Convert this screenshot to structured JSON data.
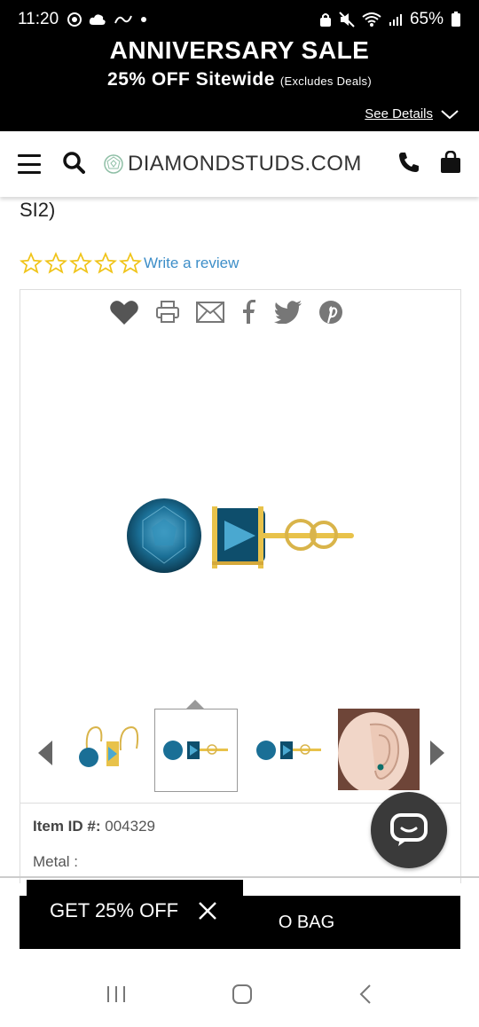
{
  "status_bar": {
    "time": "11:20",
    "battery": "65%"
  },
  "promo": {
    "title": "ANNIVERSARY SALE",
    "subtitle": "25% OFF Sitewide",
    "note": "(Excludes Deals)",
    "details_link": "See Details"
  },
  "header": {
    "logo_text": "DIAMONDSTUDS.COM"
  },
  "product": {
    "name_fragment": "SI2)",
    "rating_stars": 0,
    "review_link": "Write a review"
  },
  "info": {
    "item_id_label": "Item ID #:",
    "item_id_value": "004329",
    "metal_label": "Metal :"
  },
  "bottom": {
    "add_bag_label": "O BAG",
    "get_off_label": "GET 25% OFF"
  },
  "colors": {
    "accent_link": "#3d8ec8",
    "star_color": "#f0c419",
    "diamond_blue": "#1a6f96",
    "gold": "#e8c24a"
  }
}
